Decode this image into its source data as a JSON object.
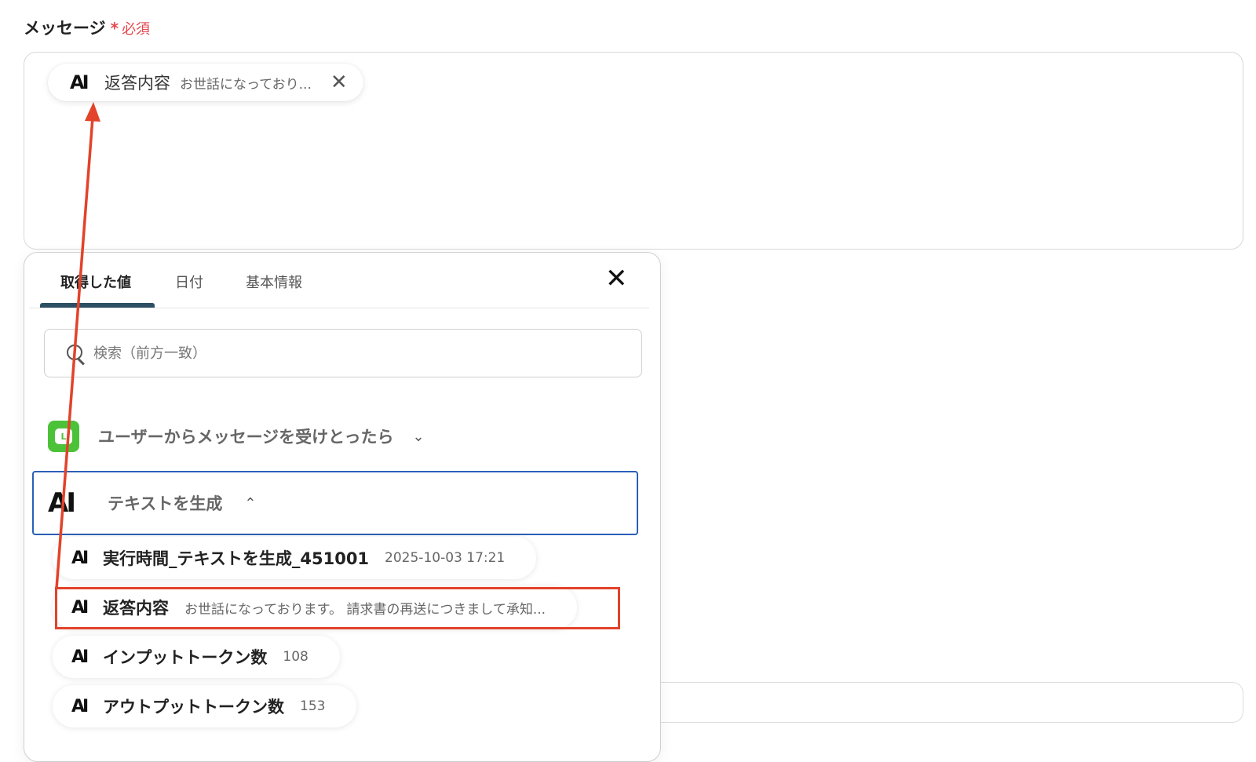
{
  "field": {
    "label": "メッセージ",
    "required_mark": "*",
    "required_text": "必須"
  },
  "message_token": {
    "icon": "AI",
    "label": "返答内容",
    "preview": "お世話になっており...",
    "close_symbol": "✕"
  },
  "popup": {
    "tabs": [
      {
        "label": "取得した値",
        "active": true
      },
      {
        "label": "日付",
        "active": false
      },
      {
        "label": "基本情報",
        "active": false
      }
    ],
    "close_symbol": "✕",
    "search": {
      "placeholder": "検索（前方一致）",
      "value": ""
    },
    "groups": [
      {
        "icon": "line-app-icon",
        "title": "ユーザーからメッセージを受けとったら",
        "expanded": false,
        "chevron": "⌄"
      },
      {
        "icon": "AI",
        "title": "テキストを生成",
        "expanded": true,
        "chevron": "⌃"
      }
    ],
    "items": [
      {
        "icon": "AI",
        "label": "実行時間_テキストを生成_451001",
        "value": "2025-10-03 17:21"
      },
      {
        "icon": "AI",
        "label": "返答内容",
        "value": "お世話になっております。 請求書の再送につきまして承知..."
      },
      {
        "icon": "AI",
        "label": "インプットトークン数",
        "value": "108"
      },
      {
        "icon": "AI",
        "label": "アウトプットトークン数",
        "value": "153"
      }
    ]
  },
  "colors": {
    "required": "#e5484d",
    "tab_indicator": "#2d4f63",
    "selected_group_border": "#2a5fb8",
    "annotation": "#e2432a",
    "line_green": "#4cc239"
  }
}
